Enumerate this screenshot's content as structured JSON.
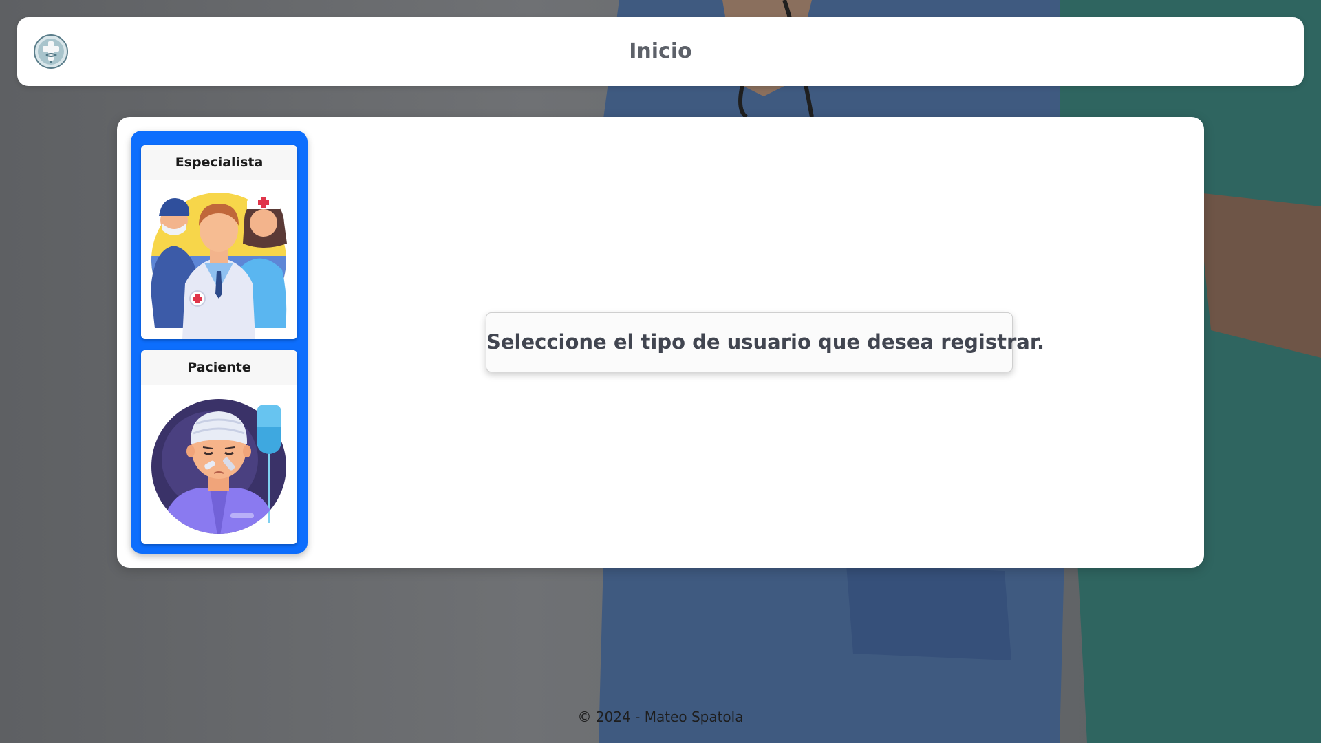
{
  "header": {
    "title": "Inicio",
    "logo_icon": "medical-caduceus-logo"
  },
  "user_types": [
    {
      "label": "Especialista",
      "icon": "medical-staff-group-illustration"
    },
    {
      "label": "Paciente",
      "icon": "injured-patient-illustration"
    }
  ],
  "main": {
    "message": "Seleccione el tipo de usuario que desea registrar."
  },
  "footer": {
    "text": "© 2024 - Mateo Spatola"
  },
  "colors": {
    "accent": "#0d6efd",
    "title": "#5d6169",
    "panel": "#ffffff"
  }
}
